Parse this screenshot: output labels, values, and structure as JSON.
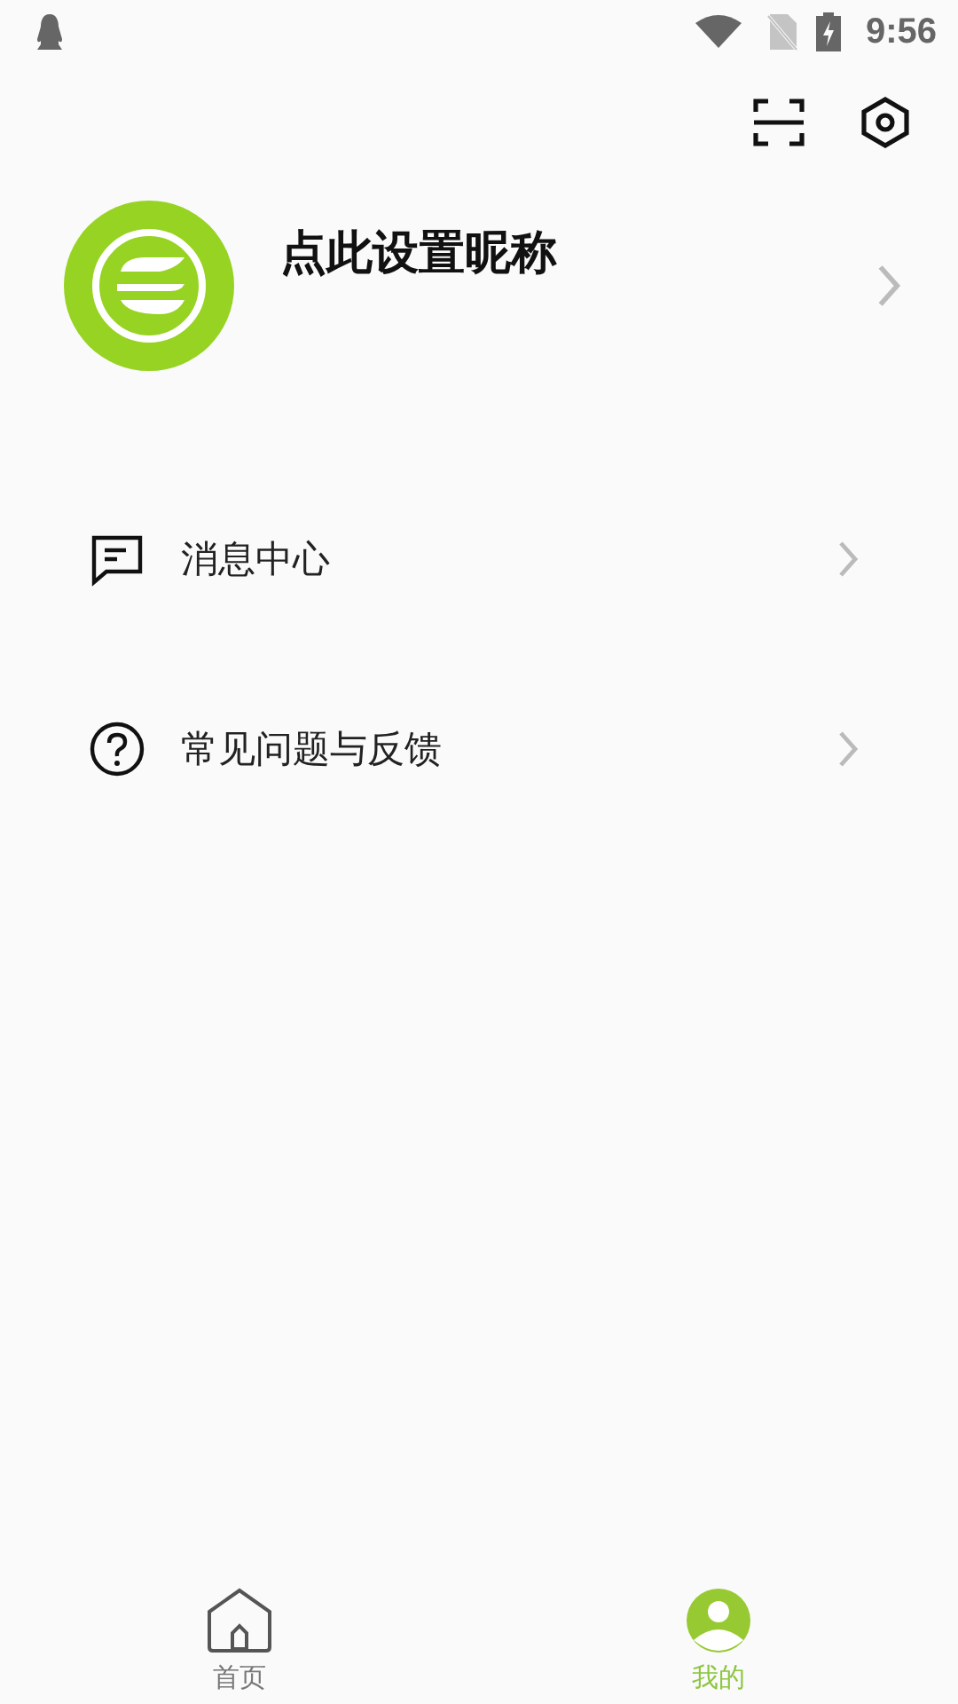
{
  "status_bar": {
    "time": "9:56"
  },
  "profile": {
    "nickname": "点此设置昵称"
  },
  "menu": [
    {
      "kind": "message",
      "label": "消息中心"
    },
    {
      "kind": "help",
      "label": "常见问题与反馈"
    }
  ],
  "tabs": [
    {
      "kind": "home",
      "label": "首页",
      "selected": false
    },
    {
      "kind": "profile",
      "label": "我的",
      "selected": true
    }
  ]
}
